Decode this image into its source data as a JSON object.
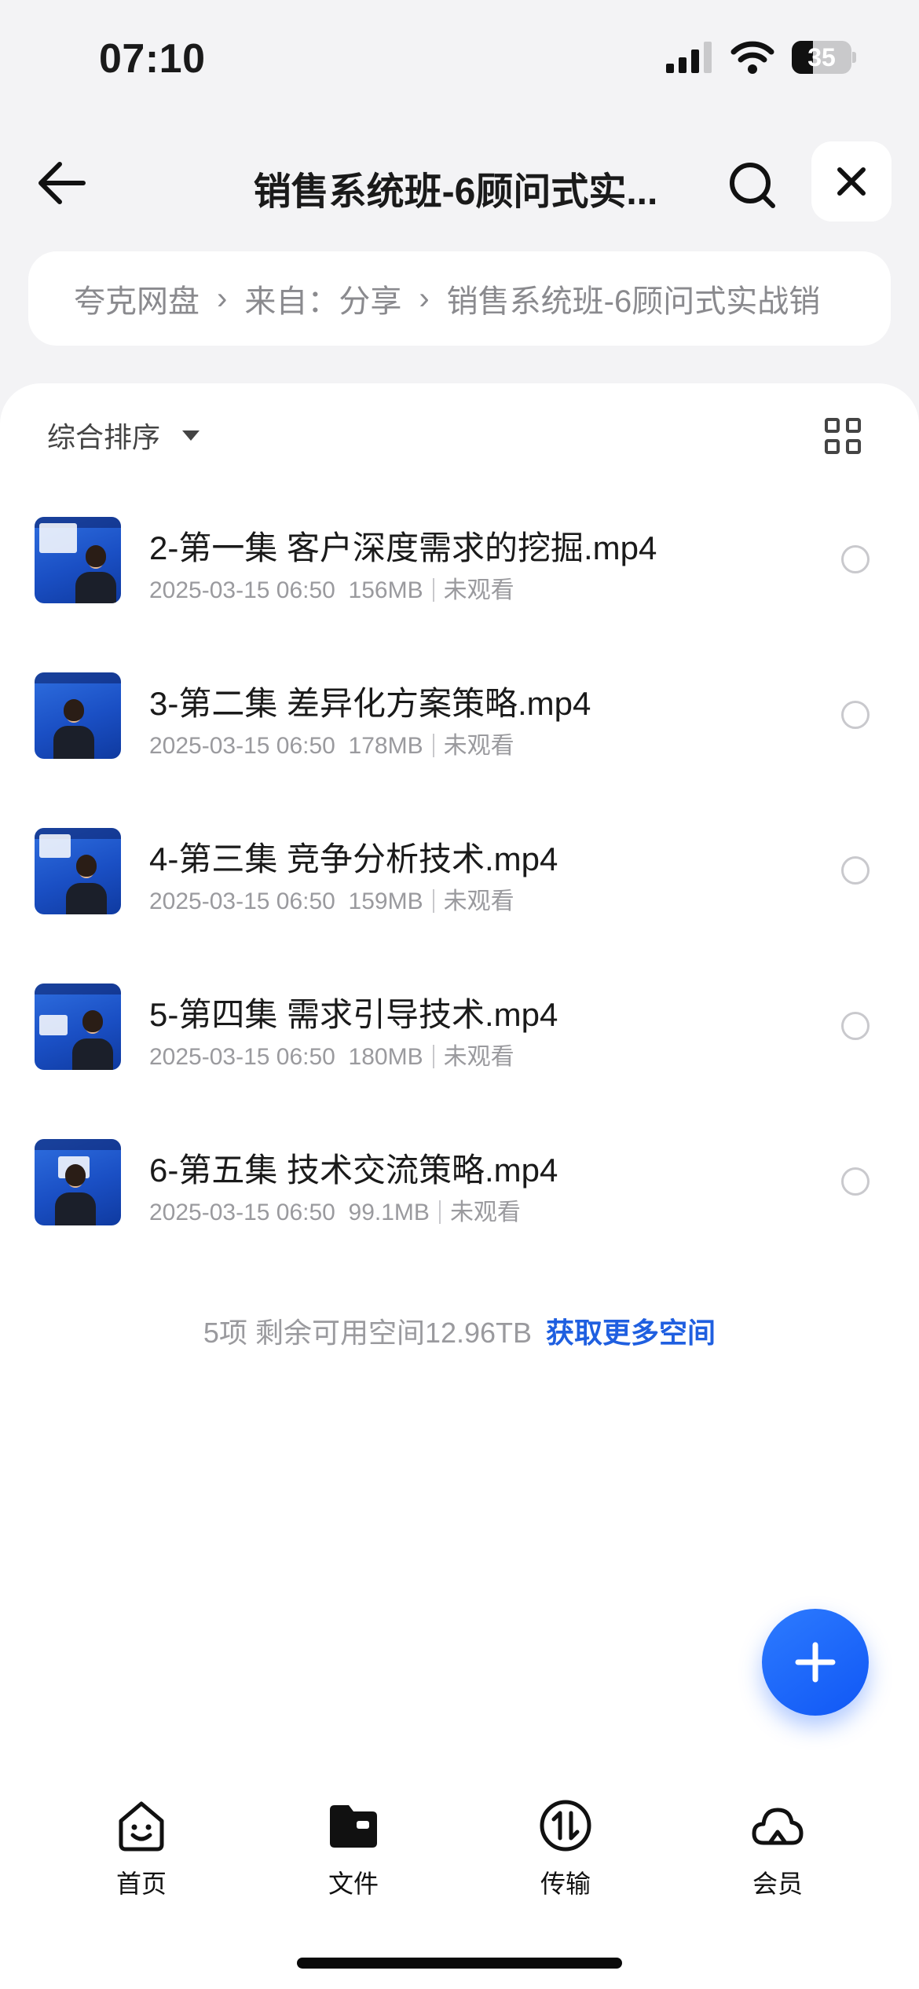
{
  "status_bar": {
    "time": "07:10",
    "battery_level": "35"
  },
  "header": {
    "title": "销售系统班-6顾问式实...",
    "back_icon": "back-arrow-icon",
    "search_icon": "search-icon",
    "close_icon": "close-icon"
  },
  "breadcrumb": {
    "items": [
      "夸克网盘",
      "来自：分享",
      "销售系统班-6顾问式实战销"
    ]
  },
  "sort": {
    "label": "综合排序"
  },
  "files": [
    {
      "name": "2-第一集 客户深度需求的挖掘.mp4",
      "date": "2025-03-15 06:50",
      "size": "156MB",
      "status": "未观看"
    },
    {
      "name": "3-第二集 差异化方案策略.mp4",
      "date": "2025-03-15 06:50",
      "size": "178MB",
      "status": "未观看"
    },
    {
      "name": "4-第三集 竞争分析技术.mp4",
      "date": "2025-03-15 06:50",
      "size": "159MB",
      "status": "未观看"
    },
    {
      "name": "5-第四集 需求引导技术.mp4",
      "date": "2025-03-15 06:50",
      "size": "180MB",
      "status": "未观看"
    },
    {
      "name": "6-第五集 技术交流策略.mp4",
      "date": "2025-03-15 06:50",
      "size": "99.1MB",
      "status": "未观看"
    }
  ],
  "footer": {
    "summary": "5项 剩余可用空间12.96TB",
    "link": "获取更多空间"
  },
  "tabs": [
    {
      "label": "首页",
      "icon": "home-smile-icon"
    },
    {
      "label": "文件",
      "icon": "folder-icon"
    },
    {
      "label": "传输",
      "icon": "transfer-icon"
    },
    {
      "label": "会员",
      "icon": "cloud-icon"
    }
  ],
  "colors": {
    "accent": "#1f5fe0",
    "background": "#f3f3f5"
  }
}
